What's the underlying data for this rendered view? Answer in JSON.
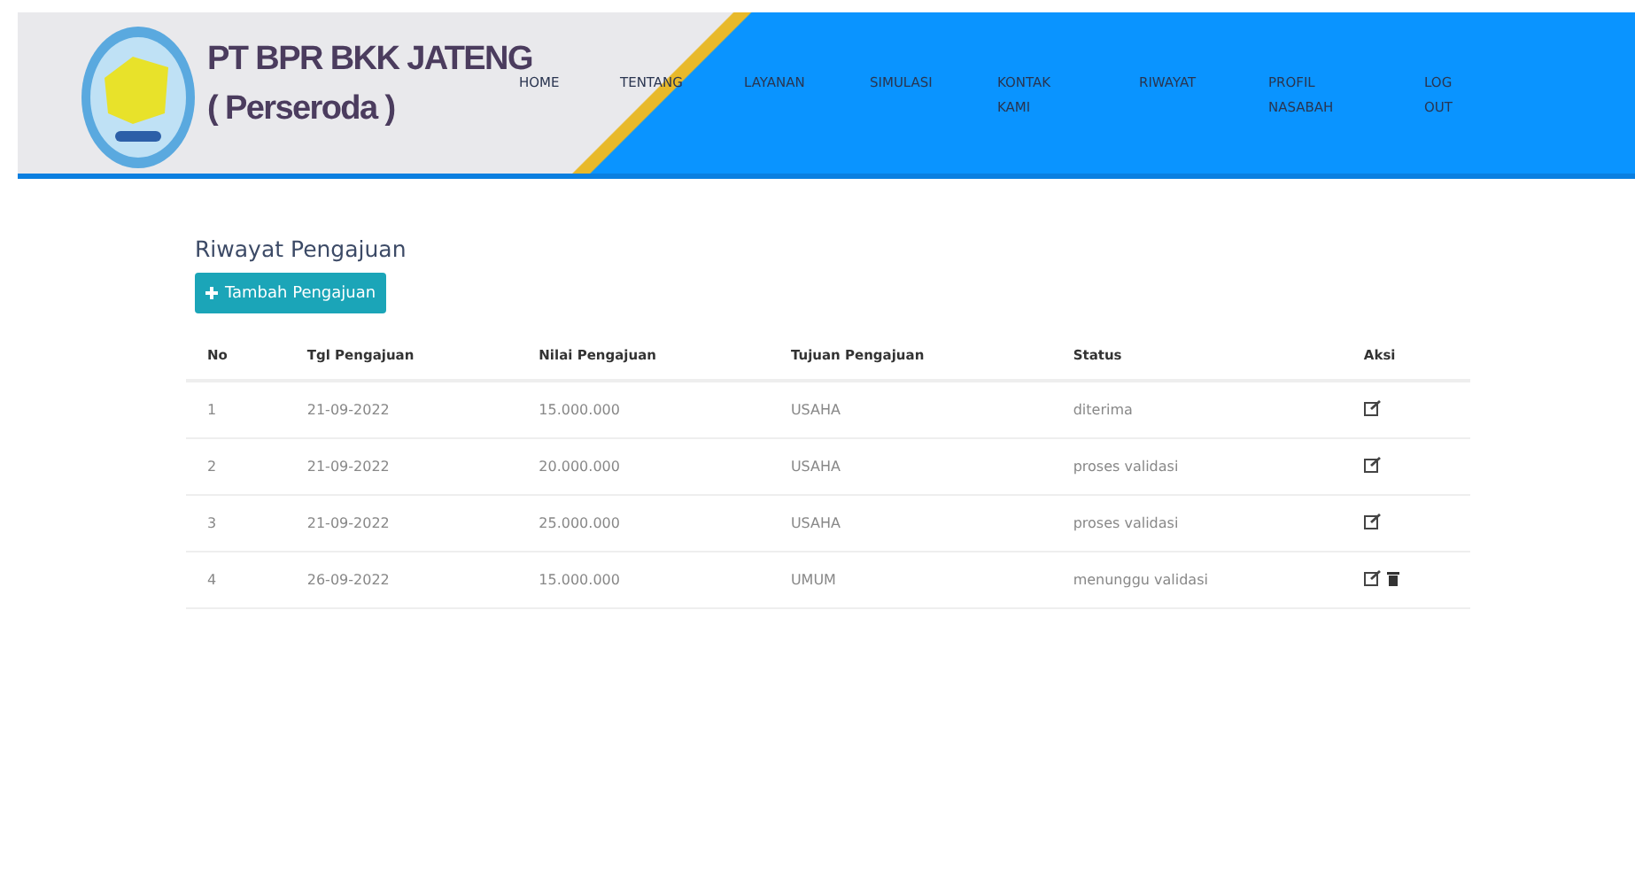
{
  "header": {
    "brand_line_1": "PT BPR BKK JATENG",
    "brand_line_2": "( Perseroda )",
    "nav": [
      {
        "lines": [
          "HOME"
        ]
      },
      {
        "lines": [
          "TENTANG"
        ]
      },
      {
        "lines": [
          "LAYANAN"
        ]
      },
      {
        "lines": [
          "SIMULASI"
        ]
      },
      {
        "lines": [
          "KONTAK",
          "KAMI"
        ]
      },
      {
        "lines": [
          "RIWAYAT"
        ]
      },
      {
        "lines": [
          "PROFIL",
          "NASABAH"
        ]
      },
      {
        "lines": [
          "LOG",
          "OUT"
        ]
      }
    ]
  },
  "page": {
    "title": "Riwayat Pengajuan",
    "add_button": "Tambah Pengajuan"
  },
  "table": {
    "columns": [
      "No",
      "Tgl Pengajuan",
      "Nilai Pengajuan",
      "Tujuan Pengajuan",
      "Status",
      "Aksi"
    ],
    "rows": [
      {
        "no": "1",
        "date": "21-09-2022",
        "amount": "15.000.000",
        "purpose": "USAHA",
        "status": "diterima",
        "actions": [
          {
            "kind": "edit"
          }
        ]
      },
      {
        "no": "2",
        "date": "21-09-2022",
        "amount": "20.000.000",
        "purpose": "USAHA",
        "status": "proses validasi",
        "actions": [
          {
            "kind": "edit"
          }
        ]
      },
      {
        "no": "3",
        "date": "21-09-2022",
        "amount": "25.000.000",
        "purpose": "USAHA",
        "status": "proses validasi",
        "actions": [
          {
            "kind": "edit"
          }
        ]
      },
      {
        "no": "4",
        "date": "26-09-2022",
        "amount": "15.000.000",
        "purpose": "UMUM",
        "status": "menunggu validasi",
        "actions": [
          {
            "kind": "edit"
          },
          {
            "kind": "delete"
          }
        ]
      }
    ]
  }
}
